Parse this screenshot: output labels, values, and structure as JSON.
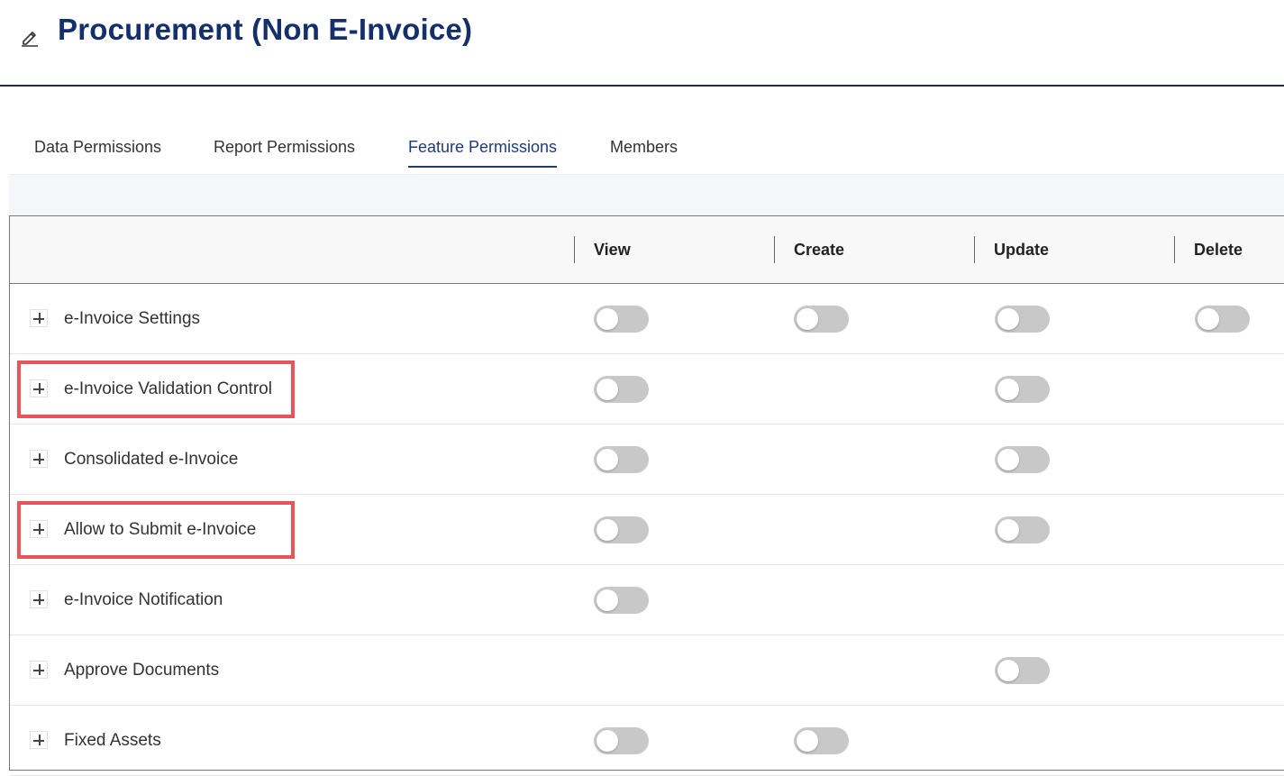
{
  "header": {
    "title": "Procurement (Non E-Invoice)",
    "edit_icon": "pencil-icon"
  },
  "tabs": [
    {
      "label": "Data Permissions",
      "active": false
    },
    {
      "label": "Report Permissions",
      "active": false
    },
    {
      "label": "Feature Permissions",
      "active": true
    },
    {
      "label": "Members",
      "active": false
    }
  ],
  "table": {
    "columns": [
      "View",
      "Create",
      "Update",
      "Delete"
    ],
    "rows": [
      {
        "label": "e-Invoice Settings",
        "view": false,
        "create": false,
        "update": false,
        "delete": false,
        "highlighted": false
      },
      {
        "label": "e-Invoice Validation Control",
        "view": false,
        "update": false,
        "highlighted": true
      },
      {
        "label": "Consolidated e-Invoice",
        "view": false,
        "update": false,
        "highlighted": false
      },
      {
        "label": "Allow to Submit e-Invoice",
        "view": false,
        "update": false,
        "highlighted": true
      },
      {
        "label": "e-Invoice Notification",
        "view": false,
        "highlighted": false
      },
      {
        "label": "Approve Documents",
        "update": false,
        "highlighted": false
      },
      {
        "label": "Fixed Assets",
        "view": false,
        "create": false,
        "highlighted": false
      }
    ]
  },
  "colors": {
    "title": "#14306b",
    "active_tab": "#1c3c78",
    "toggle_off": "#c8c8c8",
    "highlight": "#e8545c"
  }
}
